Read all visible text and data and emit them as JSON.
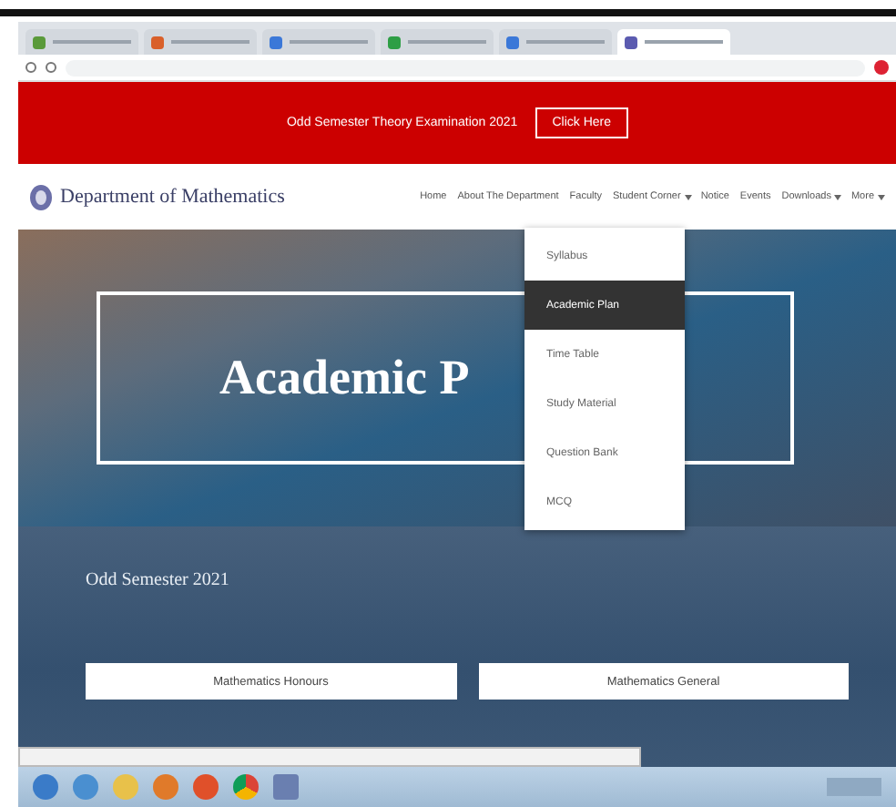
{
  "browser": {
    "tabs": [
      {
        "selected": false
      },
      {
        "selected": false
      },
      {
        "selected": false
      },
      {
        "selected": false
      },
      {
        "selected": false
      },
      {
        "selected": true
      }
    ]
  },
  "banner": {
    "text": "Odd Semester Theory Examination 2021",
    "button": "Click Here"
  },
  "site": {
    "title": "Department of Mathematics"
  },
  "nav": [
    {
      "label": "Home",
      "dropdown": false
    },
    {
      "label": "About The Department",
      "dropdown": false
    },
    {
      "label": "Faculty",
      "dropdown": false
    },
    {
      "label": "Student Corner",
      "dropdown": true
    },
    {
      "label": "Notice",
      "dropdown": false
    },
    {
      "label": "Events",
      "dropdown": false
    },
    {
      "label": "Downloads",
      "dropdown": true
    },
    {
      "label": "More",
      "dropdown": true
    }
  ],
  "menu": [
    {
      "label": "Syllabus",
      "selected": false
    },
    {
      "label": "Academic Plan",
      "selected": true
    },
    {
      "label": "Time Table",
      "selected": false
    },
    {
      "label": "Study Material",
      "selected": false
    },
    {
      "label": "Question Bank",
      "selected": false
    },
    {
      "label": "MCQ",
      "selected": false
    }
  ],
  "hero": {
    "title": "Academic P"
  },
  "section": {
    "heading": "Odd Semester 2021",
    "buttons": [
      "Mathematics Honours",
      "Mathematics General"
    ]
  }
}
